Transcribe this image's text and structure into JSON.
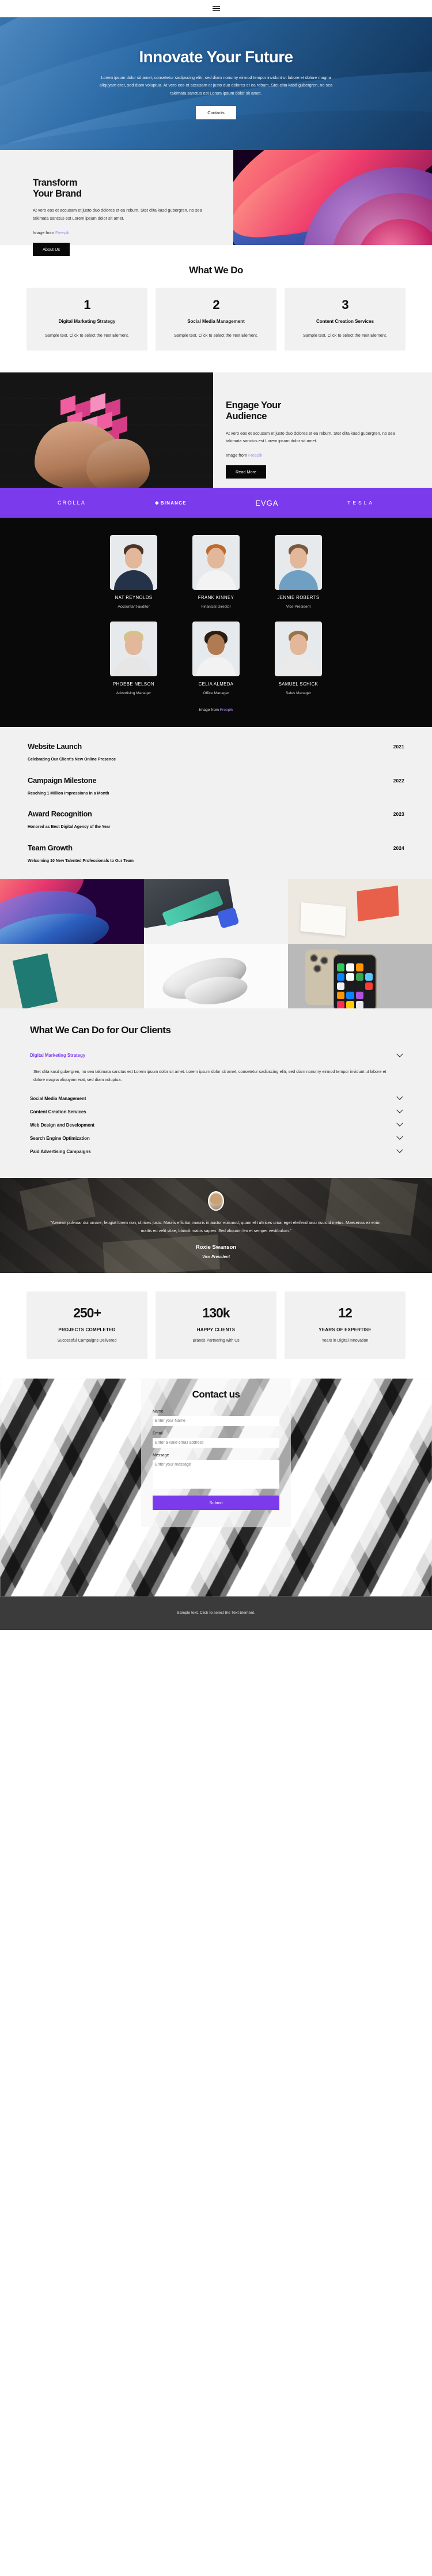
{
  "nav": {
    "menu_icon": "hamburger-menu-icon"
  },
  "hero": {
    "title": "Innovate Your Future",
    "paragraph": "Lorem ipsum dolor sit amet, consetetur sadipscing elitr, sed diam nonumy eirmod tempor invidunt ut labore et dolore magna aliquyam erat, sed diam voluptua. At vero eos et accusam et justo duo dolores et ea rebum. Stet clita kasd gubergren, no sea takimata sanctus est Lorem ipsum dolor sit amet.",
    "cta_label": "Contacts"
  },
  "transform": {
    "title_line1": "Transform",
    "title_line2": "Your Brand",
    "paragraph": "At vero eos et accusam et justo duo dolores et ea rebum. Stet clita kasd gubergren, no sea takimata sanctus est Lorem ipsum dolor sit amet.",
    "credit_prefix": "Image from ",
    "credit_link": "Freepik",
    "cta_label": "About Us"
  },
  "what_we_do": {
    "title": "What We Do",
    "cards": [
      {
        "num": "1",
        "title": "Digital Marketing Strategy",
        "desc": "Sample text. Click to select the Text Element."
      },
      {
        "num": "2",
        "title": "Social Media Management",
        "desc": "Sample text. Click to select the Text Element."
      },
      {
        "num": "3",
        "title": "Content Creation Services",
        "desc": "Sample text. Click to select the Text Element."
      }
    ]
  },
  "engage": {
    "title_line1": "Engage Your",
    "title_line2": "Audience",
    "paragraph": "At vero eos et accusam et justo duo dolores et ea rebum. Stet clita kasd gubergren, no sea takimata sanctus est Lorem ipsum dolor sit amet.",
    "credit_prefix": "Image from ",
    "credit_link": "Freepik",
    "cta_label": "Read More"
  },
  "logos": {
    "brand_color": "#7c3aed",
    "items": [
      {
        "name": "CROLLA"
      },
      {
        "name": "BINANCE"
      },
      {
        "name": "EVGA"
      },
      {
        "name": "TESLA"
      }
    ]
  },
  "team": {
    "members": [
      {
        "name": "NAT REYNOLDS",
        "role": "Accountant-auditor"
      },
      {
        "name": "FRANK KINNEY",
        "role": "Financial Director"
      },
      {
        "name": "JENNIE ROBERTS",
        "role": "Vice President"
      },
      {
        "name": "PHOEBE NELSON",
        "role": "Advertising Manager"
      },
      {
        "name": "CELIA ALMEDA",
        "role": "Office Manager"
      },
      {
        "name": "SAMUEL SCHICK",
        "role": "Sales Manager"
      }
    ],
    "credit_prefix": "Image from ",
    "credit_link": "Freepik"
  },
  "timeline": {
    "items": [
      {
        "title": "Website Launch",
        "sub": "Celebrating Our Client's New Online Presence",
        "year": "2021"
      },
      {
        "title": "Campaign Milestone",
        "sub": "Reaching 1 Million Impressions in a Month",
        "year": "2022"
      },
      {
        "title": "Award Recognition",
        "sub": "Honored as Best Digital Agency of the Year",
        "year": "2023"
      },
      {
        "title": "Team Growth",
        "sub": "Welcoming 10 New Talented Professionals to Our Team",
        "year": "2024"
      }
    ]
  },
  "gallery": {
    "items": [
      {
        "alt": "abstract-gradient-waves"
      },
      {
        "alt": "laptop-sticker-great-design-faster"
      },
      {
        "alt": "a7-greeting-card-mockup"
      },
      {
        "alt": "bifold-brochure-mockup"
      },
      {
        "alt": "white-3d-coil-render"
      },
      {
        "alt": "iphone-mockup"
      }
    ]
  },
  "accordion": {
    "title": "What We Can Do for Our Clients",
    "active_color": "#7c3aed",
    "items": [
      {
        "label": "Digital Marketing Strategy",
        "open": true,
        "body": "Stet clita kasd gubergren, no sea takimata sanctus est Lorem ipsum dolor sit amet. Lorem ipsum dolor sit amet, consetetur sadipscing elitr, sed diam nonumy eirmod tempor invidunt ut labore et dolore magna aliquyam erat, sed diam voluptua."
      },
      {
        "label": "Social Media Management",
        "open": false,
        "body": ""
      },
      {
        "label": "Content Creation Services",
        "open": false,
        "body": ""
      },
      {
        "label": "Web Design and Development",
        "open": false,
        "body": ""
      },
      {
        "label": "Search Engine Optimization",
        "open": false,
        "body": ""
      },
      {
        "label": "Paid Advertising Campaigns",
        "open": false,
        "body": ""
      }
    ]
  },
  "testimonial": {
    "quote": "\"Aenean pulvinar dui ornare, feugiat lorem non, ultrices justo. Mauris efficitur, mauris in auctor euismod, quam elit ultrices urna, eget eleifend arcu risus id metus. Maecenas ex enim, mattis eu velit vitae, blandit mattis sapien. Sed aliquam leo et semper vestibulum.\"",
    "name": "Roxie Swanson",
    "role": "Vice President"
  },
  "stats": {
    "items": [
      {
        "num": "250+",
        "label": "PROJECTS COMPLETED",
        "sub": "Successful Campaigns Delivered"
      },
      {
        "num": "130k",
        "label": "HAPPY CLIENTS",
        "sub": "Brands Partnering with Us"
      },
      {
        "num": "12",
        "label": "YEARS OF EXPERTISE",
        "sub": "Years in Digital Innovation"
      }
    ]
  },
  "contact": {
    "title": "Contact us",
    "name_label": "Name",
    "name_placeholder": "Enter your Name",
    "email_label": "Email",
    "email_placeholder": "Enter a valid email address",
    "message_label": "Message",
    "message_placeholder": "Enter your message",
    "submit_label": "Submit",
    "accent_color": "#7c3aed"
  },
  "footer": {
    "text": "Sample text. Click to select the Text Element."
  }
}
